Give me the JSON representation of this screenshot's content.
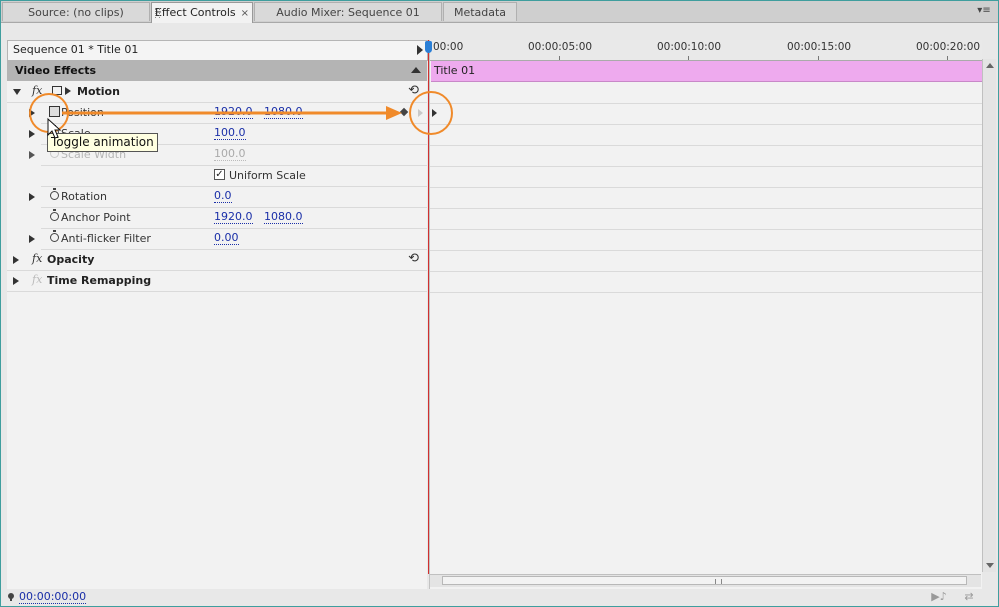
{
  "tabs": [
    {
      "label": "Source: (no clips)",
      "active": false
    },
    {
      "label": "Effect Controls",
      "active": true,
      "close": "×"
    },
    {
      "label": "Audio Mixer: Sequence 01",
      "active": false
    },
    {
      "label": "Metadata",
      "active": false
    }
  ],
  "header": {
    "sequence_title": "Sequence 01 * Title 01"
  },
  "effects": {
    "section_label": "Video Effects",
    "motion": {
      "label": "Motion",
      "fx": "fx"
    },
    "position": {
      "label": "Position",
      "x": "1920.0",
      "y": "1080.0"
    },
    "scale": {
      "label": "Scale",
      "value": "100.0"
    },
    "scale_width": {
      "label": "Scale Width",
      "value": "100.0"
    },
    "uniform_scale": {
      "label": "Uniform Scale",
      "checked": true,
      "check": "✓"
    },
    "rotation": {
      "label": "Rotation",
      "value": "0.0"
    },
    "anchor_point": {
      "label": "Anchor Point",
      "x": "1920.0",
      "y": "1080.0"
    },
    "anti_flicker": {
      "label": "Anti-flicker Filter",
      "value": "0.00"
    },
    "opacity": {
      "label": "Opacity",
      "fx": "fx"
    },
    "time_remapping": {
      "label": "Time Remapping",
      "fx": "fx"
    },
    "reset_glyph": "⟲"
  },
  "tooltip": {
    "text": "Toggle animation"
  },
  "timeline": {
    "ruler": [
      "00:00",
      "00:00:05:00",
      "00:00:10:00",
      "00:00:15:00",
      "00:00:20:00"
    ],
    "clip_label": "Title 01"
  },
  "status": {
    "timecode": "00:00:00:00"
  },
  "colors": {
    "clip": "#eeaaee",
    "playhead": "#d13030",
    "annotation": "#f08a2a",
    "value_link": "#1a2fa8"
  },
  "icons": [
    "stopwatch-icon",
    "fx-icon",
    "reset-icon",
    "keyframe-diamond-icon",
    "playhead-icon",
    "panel-menu-icon",
    "cursor-icon"
  ]
}
